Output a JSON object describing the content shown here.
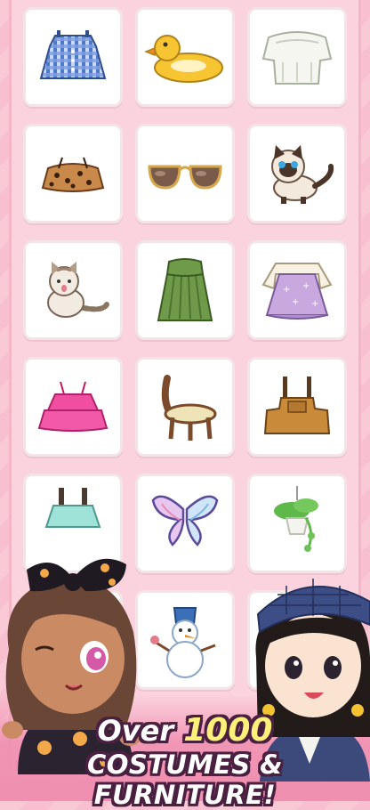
{
  "headline": {
    "prefix": "Over ",
    "number": "1000",
    "line2": "COSTUMES & FURNITURE!"
  },
  "items": [
    {
      "icon": "gingham-top-icon"
    },
    {
      "icon": "duck-float-icon"
    },
    {
      "icon": "white-blouse-icon"
    },
    {
      "icon": "leopard-top-icon"
    },
    {
      "icon": "sunglasses-icon"
    },
    {
      "icon": "siamese-cat-icon"
    },
    {
      "icon": "tabby-cat-icon"
    },
    {
      "icon": "green-dress-icon"
    },
    {
      "icon": "lavender-dress-icon"
    },
    {
      "icon": "pink-ruffle-top-icon"
    },
    {
      "icon": "wooden-chair-icon"
    },
    {
      "icon": "overalls-icon"
    },
    {
      "icon": "mint-top-icon"
    },
    {
      "icon": "butterfly-wings-icon"
    },
    {
      "icon": "hanging-plant-icon"
    },
    {
      "icon": "mint-top-icon"
    },
    {
      "icon": "snowman-icon"
    },
    {
      "icon": "hanging-plant-icon"
    }
  ],
  "colors": {
    "background": "#f9c9d6",
    "card": "#ffffff",
    "headline_text": "#ffffff",
    "headline_number": "#fff07a",
    "outline": "#4a2040"
  }
}
